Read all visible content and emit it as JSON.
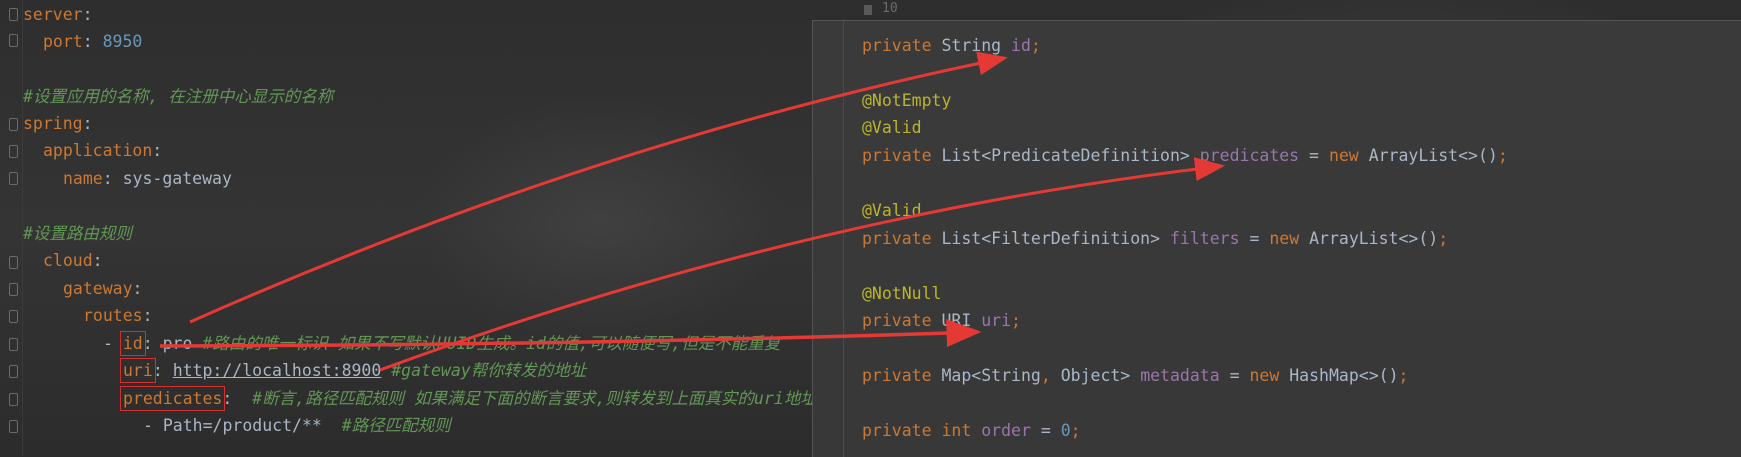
{
  "yaml": {
    "server_key": "server",
    "port_key": "port",
    "port_value": "8950",
    "comment_app_name": "#设置应用的名称, 在注册中心显示的名称",
    "spring_key": "spring",
    "application_key": "application",
    "name_key": "name",
    "name_value": "sys-gateway",
    "comment_routes": "#设置路由规则",
    "cloud_key": "cloud",
    "gateway_key": "gateway",
    "routes_key": "routes",
    "id_key": "id",
    "id_value": "pro",
    "id_comment": "#路由的唯一标识 如果不写默认UUID生成。id的值,可以随便写,但是不能重复",
    "uri_key": "uri",
    "uri_value": "http://localhost:8900",
    "uri_comment": "#gateway帮你转发的地址",
    "predicates_key": "predicates",
    "predicates_comment": "#断言,路径匹配规则 如果满足下面的断言要求,则转发到上面真实的uri地址",
    "path_value": "- Path=/product/**",
    "path_comment": "#路径匹配规则"
  },
  "popup": {
    "line_number": "10",
    "private_kw": "private",
    "new_kw": "new",
    "id_type": "String",
    "id_field": "id",
    "ann_notempty": "@NotEmpty",
    "ann_valid": "@Valid",
    "predicates_type": "List<PredicateDefinition>",
    "predicates_field": "predicates",
    "predicates_init": "ArrayList<>()",
    "filters_type": "List<FilterDefinition>",
    "filters_field": "filters",
    "filters_init": "ArrayList<>()",
    "ann_notnull": "@NotNull",
    "uri_type": "URI",
    "uri_field": "uri",
    "metadata_type": "Map<String",
    "metadata_type2": "Object>",
    "metadata_field": "metadata",
    "metadata_init": "HashMap<>()",
    "order_type": "int",
    "order_field": "order",
    "order_value": "0"
  },
  "colors": {
    "arrow": "#e53935",
    "keyword": "#cc7832",
    "comment": "#629755",
    "field": "#9876aa",
    "annotation": "#bbb529",
    "number": "#6897bb"
  }
}
